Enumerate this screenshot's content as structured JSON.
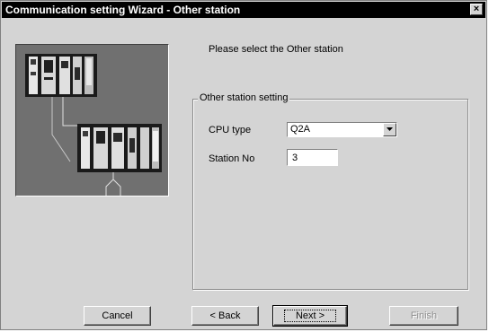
{
  "window": {
    "title": "Communication setting Wizard - Other station",
    "close_glyph": "×"
  },
  "prompt": "Please select the Other station",
  "other_station_setting": {
    "legend": "Other station setting",
    "cpu_type_label": "CPU type",
    "cpu_type_value": "Q2A",
    "station_no_label": "Station No",
    "station_no_value": "3"
  },
  "buttons": {
    "cancel": "Cancel",
    "back": "< Back",
    "next": "Next >",
    "finish": "Finish"
  },
  "colors": {
    "titlebar": "#000000",
    "dialog_face": "#d4d4d4",
    "picture_background": "#707070",
    "disabled_text": "#8e8e8e"
  },
  "icons": {
    "close": "close-icon",
    "dropdown": "dropdown-arrow-icon",
    "picture": "plc-network-illustration"
  }
}
